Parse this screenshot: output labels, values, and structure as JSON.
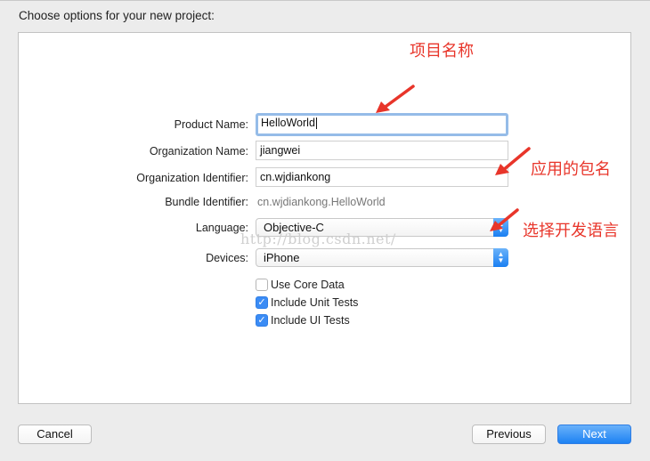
{
  "dialog": {
    "title": "Choose options for your new project:"
  },
  "form": {
    "product_name_label": "Product Name:",
    "product_name_value": "HelloWorld",
    "org_name_label": "Organization Name:",
    "org_name_value": "jiangwei",
    "org_id_label": "Organization Identifier:",
    "org_id_value": "cn.wjdiankong",
    "bundle_id_label": "Bundle Identifier:",
    "bundle_id_value": "cn.wjdiankong.HelloWorld",
    "language_label": "Language:",
    "language_value": "Objective-C",
    "devices_label": "Devices:",
    "devices_value": "iPhone"
  },
  "options": [
    {
      "label": "Use Core Data",
      "checked": false
    },
    {
      "label": "Include Unit Tests",
      "checked": true
    },
    {
      "label": "Include UI Tests",
      "checked": true
    }
  ],
  "annotations": {
    "project_name": "项目名称",
    "package_name": "应用的包名",
    "dev_language": "选择开发语言",
    "color": "#e8352a"
  },
  "watermark": "http://blog.csdn.net/",
  "buttons": {
    "cancel": "Cancel",
    "previous": "Previous",
    "next": "Next"
  },
  "icons": {
    "stepper": "up-down-stepper-icon",
    "check": "checkmark-icon",
    "arrow": "red-arrow-icon"
  }
}
